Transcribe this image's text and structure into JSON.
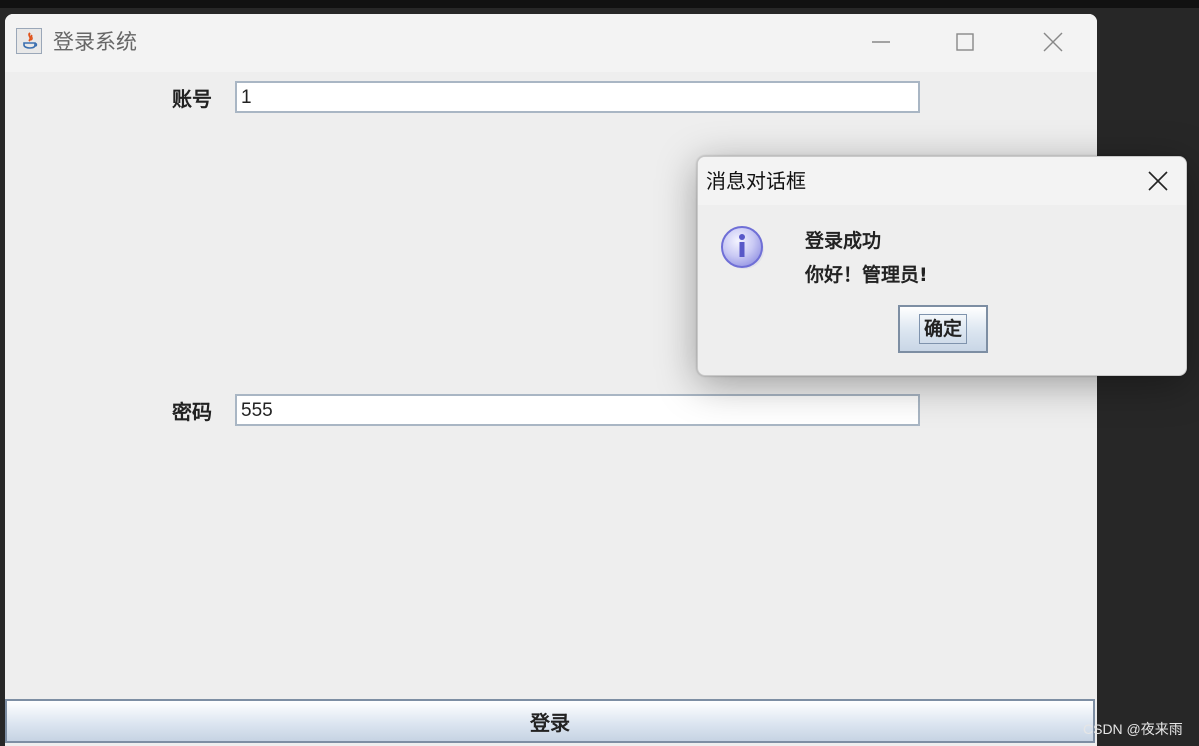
{
  "main_window": {
    "title": "登录系统",
    "controls": {
      "minimize": "minimize-icon",
      "maximize": "maximize-icon",
      "close": "close-icon"
    },
    "account_label": "账号",
    "account_value": "1",
    "password_label": "密码",
    "password_value": "555",
    "login_button": "登录"
  },
  "dialog": {
    "title": "消息对话框",
    "icon": "info-icon",
    "message_line1": "登录成功",
    "message_line2": "你好！管理员!",
    "ok_button": "确定"
  },
  "watermark": "CSDN @夜来雨",
  "colors": {
    "window_bg": "#eeeeee",
    "titlebar_bg": "#f3f3f3",
    "field_border": "#a9b6c4",
    "button_border": "#7d8ea3",
    "info_icon": "#7f7ff0"
  }
}
